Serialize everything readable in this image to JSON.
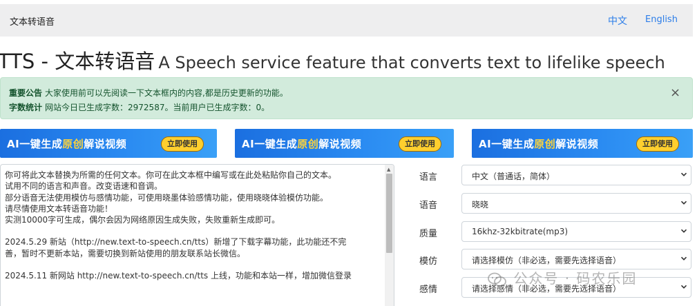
{
  "navbar": {
    "brand": "文本转语音",
    "lang_zh": "中文",
    "lang_en": "English"
  },
  "page": {
    "title_main": "TTS - 文本转语音",
    "title_sub": "A Speech service feature that converts text to lifelike speech"
  },
  "alert": {
    "notice_label": "重要公告",
    "notice_text": "大家使用前可以先阅读一下文本框内的内容,都是历史更新的功能。",
    "stats_label": "字数统计",
    "stats_text": "网站今日已生成字数：2972587。当前用户已生成字数：0。",
    "close": "×"
  },
  "banners": [
    {
      "text_before": "AI一键生成",
      "text_highlight": "原创",
      "text_after": "解说视频",
      "button": "立即使用"
    },
    {
      "text_before": "AI一键生成",
      "text_highlight": "原创",
      "text_after": "解说视频",
      "button": "立即使用"
    },
    {
      "text_before": "AI一键生成",
      "text_highlight": "原创",
      "text_after": "解说视频",
      "button": "立即使用"
    }
  ],
  "textarea": {
    "lines": [
      "你可将此文本替换为所需的任何文本。你可在此文本框中编写或在此处粘贴你自己的文本。",
      "试用不同的语言和声音。改变语速和音调。",
      "部分语音无法使用模仿与感情功能，可使用晓墨体验感情功能，使用晓晓体验模仿功能。",
      "请尽情使用文本转语音功能！",
      "实测10000字可生成，偶尔会因为网络原因生成失败，失败重新生成即可。",
      "",
      "2024.5.29 新站（http://new.text-to-speech.cn/tts）新增了下载字幕功能，此功能还不完",
      "善，暂时不更新本站，需要切换到新站使用的朋友联系站长微信。",
      "",
      "2024.5.11 新网站 http://new.text-to-speech.cn/tts 上线，功能和本站一样，增加微信登录"
    ]
  },
  "form": {
    "language_label": "语言",
    "language_value": "中文（普通话，简体）",
    "voice_label": "语音",
    "voice_value": "晓晓",
    "quality_label": "质量",
    "quality_value": "16khz-32kbitrate(mp3)",
    "imitation_label": "模仿",
    "imitation_value": "请选择模仿（非必选，需要先选择语音）",
    "emotion_label": "感情",
    "emotion_value": "请选择感情（非必选，需要先选择语音）"
  },
  "watermark": {
    "text": "公众号 · 码农乐园",
    "icon": "wechat-icon"
  },
  "colors": {
    "link": "#2b7de9",
    "alert_bg": "#d2ebdc",
    "alert_text": "#14532d",
    "banner_blue": "#1b6fe0",
    "banner_highlight": "#ffd43b",
    "banner_button": "#ffcf2e"
  }
}
